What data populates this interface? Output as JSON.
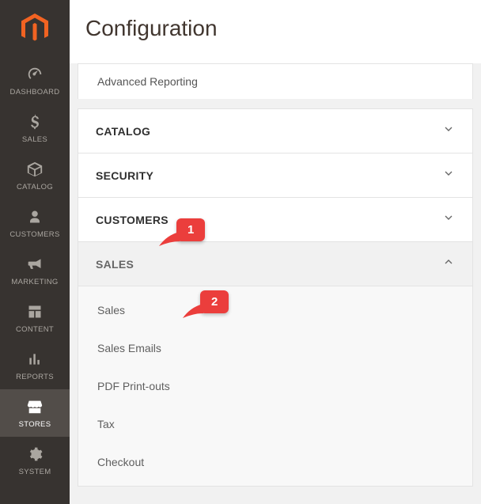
{
  "sidebar": {
    "items": [
      {
        "label": "DASHBOARD"
      },
      {
        "label": "SALES"
      },
      {
        "label": "CATALOG"
      },
      {
        "label": "CUSTOMERS"
      },
      {
        "label": "MARKETING"
      },
      {
        "label": "CONTENT"
      },
      {
        "label": "REPORTS"
      },
      {
        "label": "STORES"
      },
      {
        "label": "SYSTEM"
      }
    ]
  },
  "page": {
    "title": "Configuration"
  },
  "config": {
    "prelim_item": "Advanced Reporting",
    "sections": [
      {
        "label": "CATALOG"
      },
      {
        "label": "SECURITY"
      },
      {
        "label": "CUSTOMERS"
      }
    ],
    "expanded_section": {
      "label": "SALES",
      "items": [
        "Sales",
        "Sales Emails",
        "PDF Print-outs",
        "Tax",
        "Checkout"
      ]
    }
  },
  "annotations": {
    "a1": "1",
    "a2": "2"
  },
  "colors": {
    "accent": "#eb3e3c",
    "brand": "#f26322",
    "sidebar_bg": "#373330"
  }
}
